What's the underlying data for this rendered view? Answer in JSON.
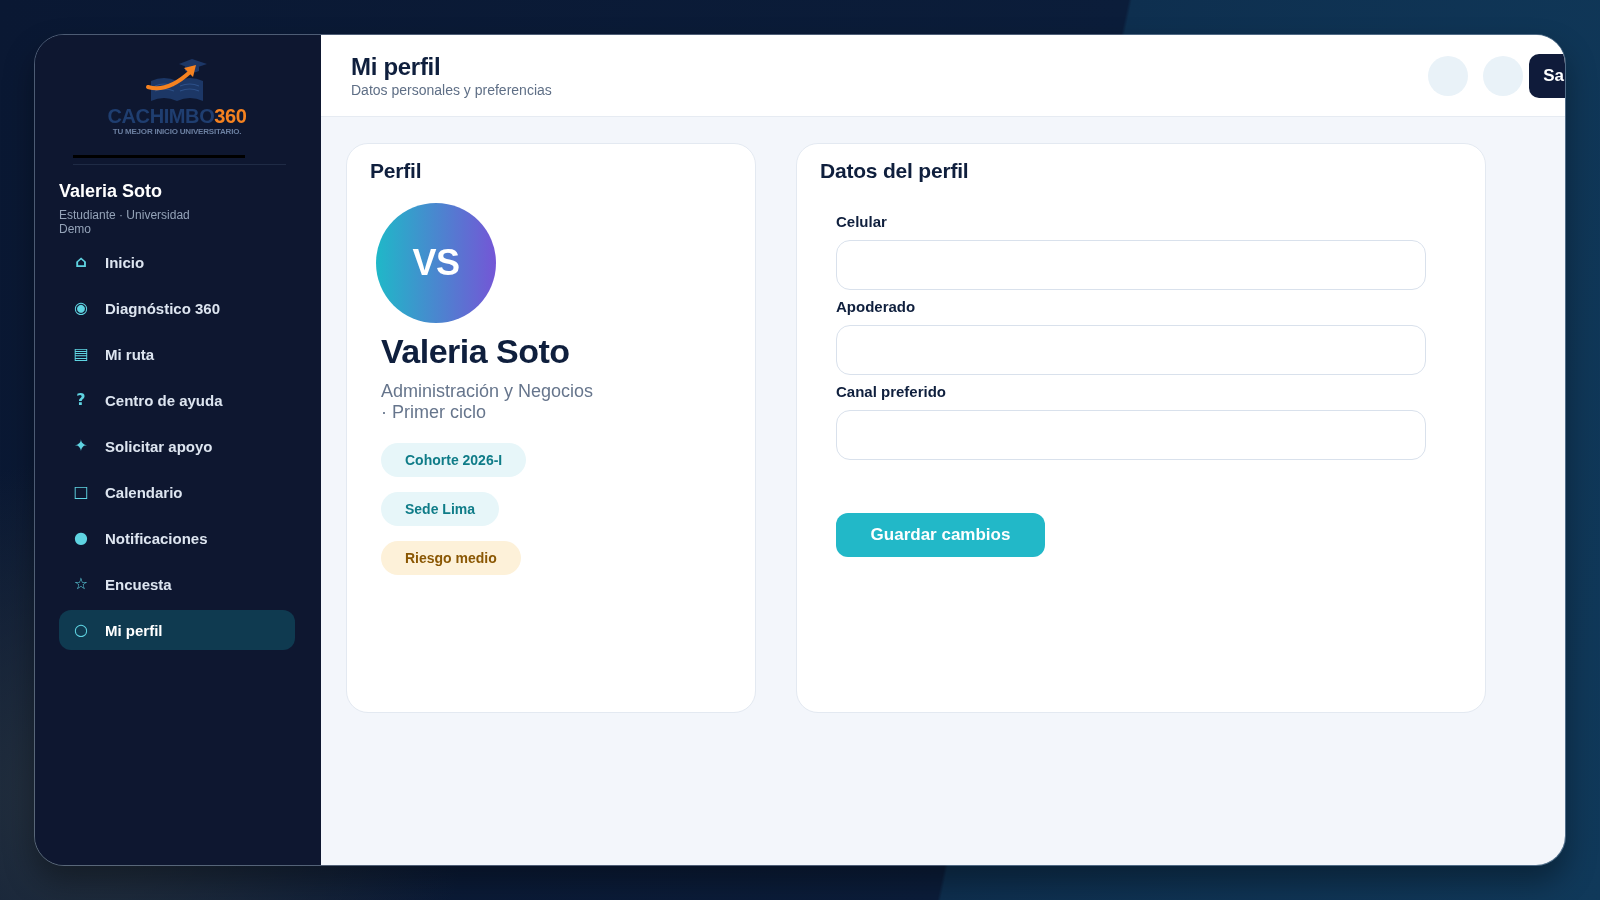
{
  "sidebar": {
    "brand": {
      "name": "CACHIMBO",
      "number": "360",
      "tagline": "TU MEJOR INICIO UNIVERSITARIO."
    },
    "user": {
      "name": "Valeria Soto",
      "role": "Estudiante · Universidad Demo"
    },
    "items": [
      {
        "icon": "⌂",
        "label": "Inicio",
        "selected": false
      },
      {
        "icon": "◉",
        "label": "Diagnóstico 360",
        "selected": false
      },
      {
        "icon": "▤",
        "label": "Mi ruta",
        "selected": false
      },
      {
        "icon": "?",
        "label": "Centro de ayuda",
        "selected": false
      },
      {
        "icon": "✦",
        "label": "Solicitar apoyo",
        "selected": false
      },
      {
        "icon": "□",
        "label": "Calendario",
        "selected": false
      },
      {
        "icon": "●",
        "label": "Notificaciones",
        "selected": false
      },
      {
        "icon": "☆",
        "label": "Encuesta",
        "selected": false
      },
      {
        "icon": "○",
        "label": "Mi perfil",
        "selected": true
      }
    ]
  },
  "header": {
    "title": "Mi perfil",
    "subtitle": "Datos personales y preferencias",
    "button": "Sa"
  },
  "profile": {
    "title": "Perfil",
    "initials": "VS",
    "name": "Valeria Soto",
    "program": "Administración y Negocios · Primer ciclo",
    "tags": [
      {
        "label": "Cohorte 2026-I",
        "kind": "info"
      },
      {
        "label": "Sede Lima",
        "kind": "info"
      },
      {
        "label": "Riesgo medio",
        "kind": "warning"
      }
    ]
  },
  "form": {
    "title": "Datos del perfil",
    "fields": [
      {
        "label": "Celular"
      },
      {
        "label": "Apoderado"
      },
      {
        "label": "Canal preferido"
      }
    ],
    "submit": "Guardar cambios"
  }
}
